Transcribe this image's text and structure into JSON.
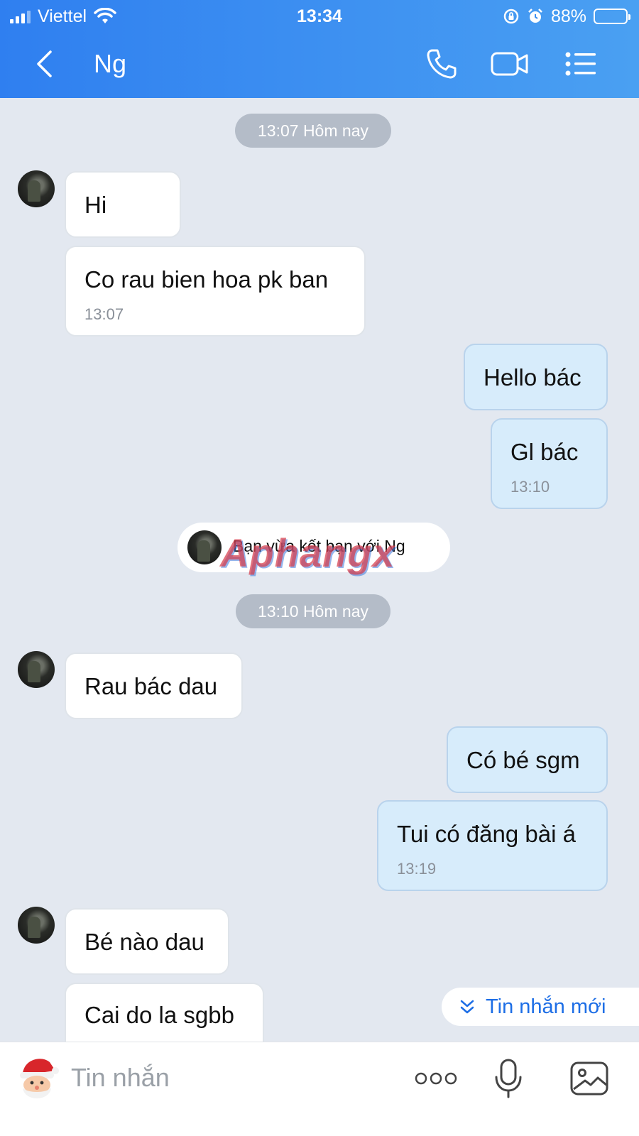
{
  "status_bar": {
    "carrier": "Viettel",
    "time": "13:34",
    "battery_text": "88%",
    "battery_level": 0.88
  },
  "header": {
    "contact_name": "Ng",
    "icons": {
      "back": "chevron-left-icon",
      "call": "phone-icon",
      "video": "video-camera-icon",
      "menu": "list-menu-icon"
    },
    "colors": {
      "gradient_start": "#2f7ff0",
      "gradient_end": "#4aa0f2"
    }
  },
  "chat": {
    "date_separators": [
      "13:07 Hôm nay",
      "13:10 Hôm nay"
    ],
    "messages": [
      {
        "side": "in",
        "text": "Hi"
      },
      {
        "side": "in",
        "text": "Co rau bien hoa pk ban",
        "time": "13:07"
      },
      {
        "side": "out",
        "text": "Hello bác"
      },
      {
        "side": "out",
        "text": "Gl bác",
        "time": "13:10"
      },
      {
        "side": "in",
        "text": "Rau bác dau"
      },
      {
        "side": "out",
        "text": "Có bé sgm"
      },
      {
        "side": "out",
        "text": "Tui có đăng bài á",
        "time": "13:19"
      },
      {
        "side": "in",
        "text": "Bé nào dau"
      },
      {
        "side": "in",
        "text": "Cai do la sgbb"
      }
    ],
    "friend_notice": "Bạn vừa kết bạn với Ng",
    "watermark": "Aphangx",
    "new_messages_label": "Tin nhắn mới"
  },
  "input_bar": {
    "placeholder": "Tin nhắn",
    "icons": {
      "sticker": "santa-sticker-icon",
      "more": "more-dots-icon",
      "voice": "microphone-icon",
      "image": "image-icon"
    }
  },
  "colors": {
    "chat_background": "#e3e8f0",
    "incoming_bubble": "#ffffff",
    "outgoing_bubble": "#d7ecfb",
    "accent": "#1d6ee6"
  }
}
